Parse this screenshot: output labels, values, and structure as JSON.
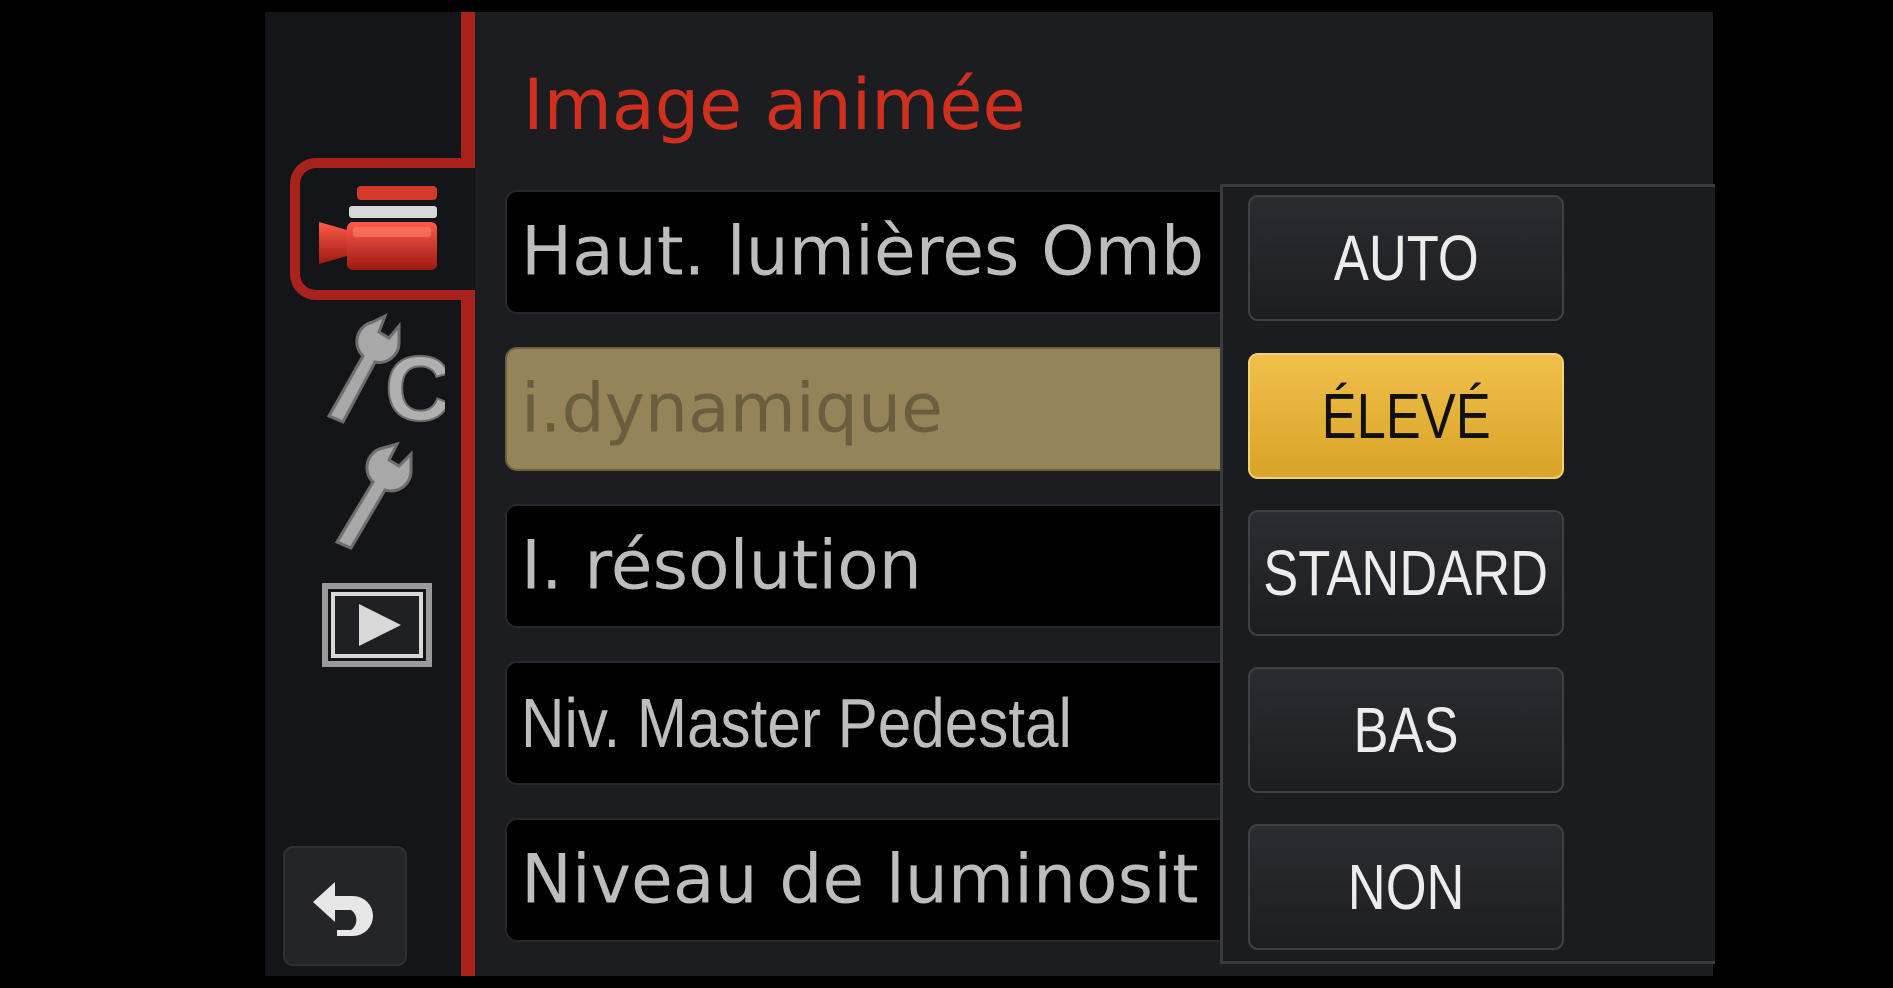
{
  "title": "Image animée",
  "colors": {
    "accent_red": "#a9231c",
    "title_red": "#d1301f",
    "selected_option": "#e0ad30",
    "selected_row": "#958458"
  },
  "tabs": [
    {
      "icon": "movie-camera-icon",
      "active": true
    },
    {
      "icon": "custom-wrench-c-icon",
      "active": false
    },
    {
      "icon": "wrench-icon",
      "active": false
    },
    {
      "icon": "playback-icon",
      "active": false
    }
  ],
  "back_icon": "return-arrow-icon",
  "menu_items": [
    {
      "label": "Haut. lumières Omb"
    },
    {
      "label": "i.dynamique"
    },
    {
      "label": "I. résolution"
    },
    {
      "label": "Niv. Master Pedestal"
    },
    {
      "label": "Niveau de luminosit"
    }
  ],
  "options": [
    {
      "label": "AUTO"
    },
    {
      "label": "ÉLEVÉ"
    },
    {
      "label": "STANDARD"
    },
    {
      "label": "BAS"
    },
    {
      "label": "NON"
    }
  ],
  "selected_option": "ÉLEVÉ"
}
